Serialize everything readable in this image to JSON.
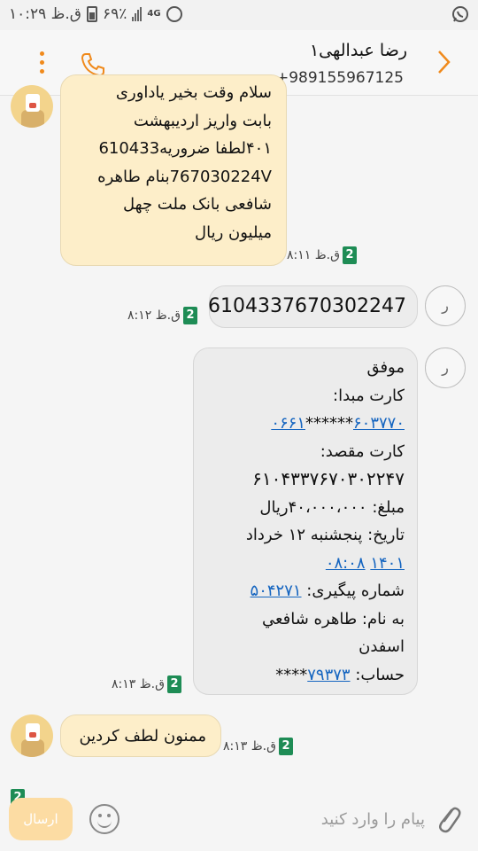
{
  "status_bar": {
    "time": "۱۰:۲۹ ق.ظ",
    "battery": "۶۹٪",
    "network": "4G",
    "icons": [
      "whatsapp-icon",
      "battery-icon",
      "signal-icon",
      "alarm-icon"
    ]
  },
  "header": {
    "contact_name": "رضا عبدالهی۱",
    "phone": "+989155967125"
  },
  "messages": {
    "m1": {
      "lines": [
        "سلام وقت بخیر یاداوری",
        "بابت واریز اردیبهشت",
        "۴۰۱لطفا ضروریه610433",
        "767030224Vبنام طاهره",
        "شافعی بانک ملت چهل",
        "میلیون ریال"
      ],
      "time": "۸:۱۱ ق.ظ",
      "sim": "2"
    },
    "m2": {
      "avatar_letter": "ر",
      "text": "6104337670302247",
      "time": "۸:۱۲ ق.ظ",
      "sim": "2"
    },
    "m3": {
      "avatar_letter": "ر",
      "status": "موفق",
      "src_label": "کارت مبدا:",
      "src_a": "۶۰۳۷۷۰",
      "src_mask": "******",
      "src_b": "۰۶۶۱",
      "dst_label": "کارت مقصد:",
      "dst_num": "۶۱۰۴۳۳۷۶۷۰۳۰۲۲۴۷",
      "amount": "مبلغ: ۴۰،۰۰۰،۰۰۰ریال",
      "date": "تاریخ: پنجشنبه ۱۲ خرداد",
      "date_year": "۱۴۰۱",
      "date_time": "۰۸:۰۸",
      "track_label": "شماره پیگیری:",
      "track_num": "۵۰۴۲۷۱",
      "name1": "به نام: طاهره شافعي",
      "name2": "اسفدن",
      "acc_label": "حساب:",
      "acc_num": "۷۹۳۷۳",
      "acc_mask": "****",
      "time": "۸:۱۳ ق.ظ",
      "sim": "2"
    },
    "m4": {
      "text": "ممنون لطف کردین",
      "time": "۸:۱۳ ق.ظ",
      "sim": "2"
    }
  },
  "composer": {
    "placeholder": "پیام را وارد کنید",
    "send_label": "ارسال",
    "sim": "2"
  },
  "colors": {
    "incoming_bubble": "#fdeec9",
    "outgoing_bubble": "#ececec",
    "sim_badge": "#1e8c55",
    "accent": "#f08a1c",
    "link": "#1565c0"
  }
}
